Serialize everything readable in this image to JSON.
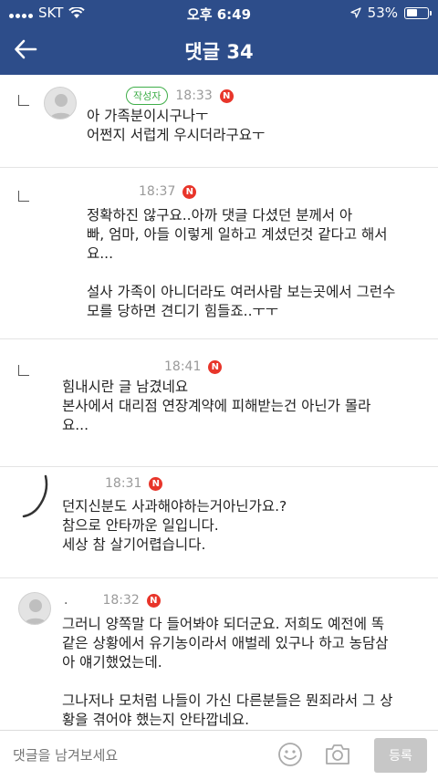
{
  "status_bar": {
    "carrier": "SKT",
    "time": "오후 6:49",
    "battery": "53%",
    "battery_level": 0.53
  },
  "header": {
    "title": "댓글 34",
    "back_icon": "arrow-left-icon"
  },
  "comments": [
    {
      "author_badge": "작성자",
      "time": "18:33",
      "new_label": "N",
      "text": "아 가족분이시구나ㅜ\n어쩐지 서럽게 우시더라구요ㅜ"
    },
    {
      "time": "18:37",
      "new_label": "N",
      "text": "정확하진 않구요..아까 댓글 다셨던 분께서 아\n빠, 엄마, 아들 이렇게 일하고 계셨던것 같다고 해서\n요...\n\n설사 가족이 아니더라도 여러사람 보는곳에서 그런수\n모를 당하면 견디기 힘들죠..ㅜㅜ"
    },
    {
      "time": "18:41",
      "new_label": "N",
      "text": "힘내시란 글 남겼네요\n본사에서 대리점 연장계약에 피해받는건 아닌가 몰라\n요..."
    },
    {
      "time": "18:31",
      "new_label": "N",
      "text": "던지신분도 사과해야하는거아닌가요.?\n참으로 안타까운 일입니다.\n세상 참 살기어렵습니다."
    },
    {
      "author": ".",
      "time": "18:32",
      "new_label": "N",
      "text": "그러니 양쪽말 다 들어봐야 되더군요. 저희도 예전에 똑\n같은 상황에서 유기농이라서 애벌레 있구나 하고 농담삼\n아 얘기했었는데.\n\n그나저나 모처럼 나들이 가신 다른분들은 뭔죄라서 그 상\n황을 겪어야 했는지 안타깝네요."
    }
  ],
  "bottom_bar": {
    "placeholder": "댓글을 남겨보세요",
    "submit_label": "등록",
    "emoji_icon": "emoji-icon",
    "camera_icon": "camera-icon"
  },
  "colors": {
    "header_bg": "#2d4d8a",
    "author_badge": "#3fae49",
    "new_badge": "#e8352a"
  }
}
